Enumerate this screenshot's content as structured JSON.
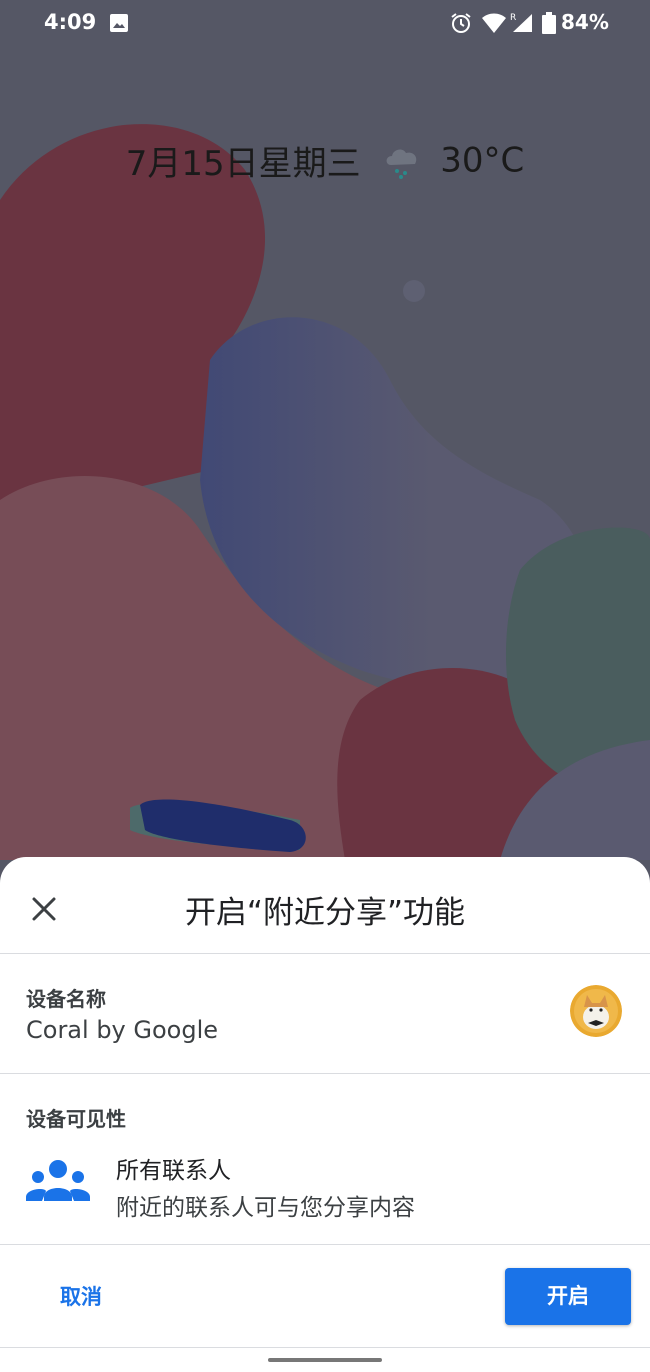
{
  "status_bar": {
    "time": "4:09",
    "battery": "84%",
    "icons": [
      "image-icon",
      "alarm-icon",
      "wifi-icon",
      "signal-roaming-icon",
      "battery-icon"
    ]
  },
  "at_a_glance": {
    "date": "7月15日星期三",
    "temperature": "30°C",
    "weather_icon": "rain-cloud-icon"
  },
  "sheet": {
    "title": "开启“附近分享”功能",
    "close_icon": "close-icon",
    "device_name_section": {
      "label": "设备名称",
      "value": "Coral by Google"
    },
    "visibility_section": {
      "label": "设备可见性",
      "option_title": "所有联系人",
      "option_subtitle": "附近的联系人可与您分享内容",
      "icon": "people-group-icon"
    },
    "actions": {
      "cancel_label": "取消",
      "enable_label": "开启"
    }
  },
  "colors": {
    "accent": "#1a73e8",
    "wallpaper_base": "#555765",
    "sheet_bg": "#ffffff"
  }
}
